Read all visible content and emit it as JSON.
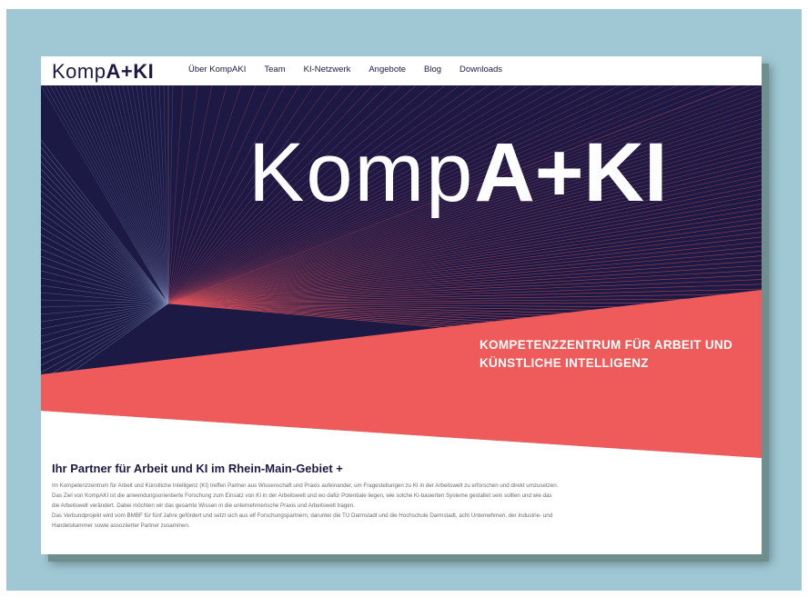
{
  "header": {
    "logo_light": "Komp",
    "logo_bold": "A+KI",
    "nav": [
      "Über KompAKI",
      "Team",
      "KI-Netzwerk",
      "Angebote",
      "Blog",
      "Downloads"
    ]
  },
  "hero": {
    "title_light": "Komp",
    "title_bold": "A+KI",
    "tagline_line1": "KOMPETENZZENTRUM FÜR ARBEIT UND",
    "tagline_line2": "KÜNSTLICHE INTELLIGENZ"
  },
  "content": {
    "heading": "Ihr Partner für Arbeit und KI im Rhein-Main-Gebiet +",
    "lines": [
      "Im Kompetenzzentrum für Arbeit und Künstliche Intelligenz (KI) treffen Partner aus Wissenschaft und Praxis aufeinander, um Fragestellungen zu KI in der Arbeitswelt zu erforschen und direkt umzusetzen.",
      "Das Ziel von KompAKI ist die anwendungsorientierte Forschung zum Einsatz von KI in der Arbeitswelt und wo dafür Potentiale liegen, wie solche KI-basierten Systeme gestaltet sein sollten und wie das",
      "die Arbeitswelt verändert. Dabei möchten wir das gesamte Wissen in die unternehmerische Praxis und Arbeitswelt tragen.",
      "Das Verbundprojekt wird vom BMBF für fünf Jahre gefördert und setzt sich aus elf Forschungspartnern, darunter die TU Darmstadt und die Hochschule Darmstadt, acht Unternehmen, der Industrie- und",
      "Handelskammer sowie assoziierter Partner zusammen."
    ]
  },
  "colors": {
    "navy": "#1c1a45",
    "coral": "#ef5a5a",
    "frame": "#9fc8d4"
  }
}
